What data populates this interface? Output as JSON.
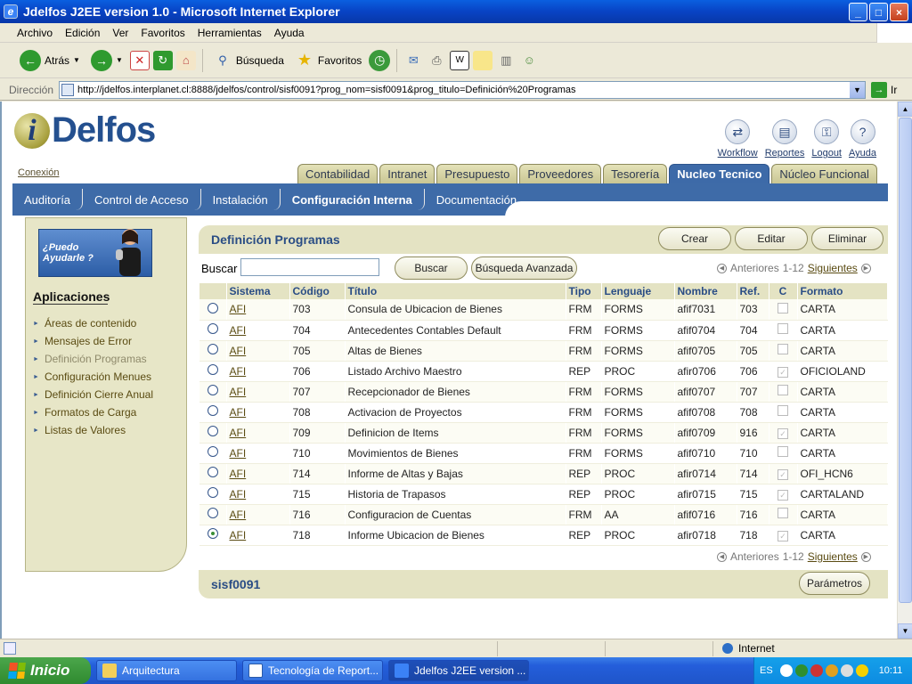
{
  "window": {
    "title": "Jdelfos J2EE version 1.0 - Microsoft Internet Explorer",
    "controls": {
      "minimize": "_",
      "maximize": "□",
      "close": "×"
    }
  },
  "menu": [
    "Archivo",
    "Edición",
    "Ver",
    "Favoritos",
    "Herramientas",
    "Ayuda"
  ],
  "toolbar": {
    "back": "Atrás",
    "search": "Búsqueda",
    "favorites": "Favoritos"
  },
  "address": {
    "label": "Dirección",
    "url": "http://jdelfos.interplanet.cl:8888/jdelfos/control/sisf0091?prog_nom=sisf0091&prog_titulo=Definición%20Programas",
    "go": "Ir"
  },
  "app": {
    "logo_i": "i",
    "logo_word": "Delfos",
    "conexion": "Conexión",
    "tools": [
      {
        "label": "Workflow",
        "icon": "workflow-icon",
        "glyph": "⇄"
      },
      {
        "label": "Reportes",
        "icon": "reports-icon",
        "glyph": "▤"
      },
      {
        "label": "Logout",
        "icon": "key-icon",
        "glyph": "⚿"
      },
      {
        "label": "Ayuda",
        "icon": "help-icon",
        "glyph": "?"
      }
    ],
    "top_tabs": [
      "Contabilidad",
      "Intranet",
      "Presupuesto",
      "Proveedores",
      "Tesorería",
      "Nucleo Tecnico",
      "Núcleo Funcional"
    ],
    "top_tab_active": "Nucleo Tecnico",
    "sub_tabs": [
      "Auditoría",
      "Control de Acceso",
      "Instalación",
      "Configuración Interna",
      "Documentación"
    ],
    "sub_tab_active": "Configuración Interna"
  },
  "sidebar": {
    "help_banner": "¿Puedo Ayudarle ?",
    "title": "Aplicaciones",
    "items": [
      "Áreas de contenido",
      "Mensajes de Error",
      "Definición Programas",
      "Configuración Menues",
      "Definición Cierre Anual",
      "Formatos de Carga",
      "Listas de Valores"
    ],
    "current": "Definición Programas"
  },
  "panel": {
    "title": "Definición Programas",
    "actions": {
      "create": "Crear",
      "edit": "Editar",
      "delete": "Eliminar"
    },
    "search_label": "Buscar",
    "search_value": "",
    "search_button": "Buscar",
    "advanced_button": "Búsqueda Avanzada",
    "pager_prev": "Anteriores",
    "pager_range": "1-12",
    "pager_next": "Siguientes",
    "footer_title": "sisf0091",
    "params_button": "Parámetros"
  },
  "table": {
    "headers": [
      "Sistema",
      "Código",
      "Título",
      "Tipo",
      "Lenguaje",
      "Nombre",
      "Ref.",
      "C",
      "Formato"
    ],
    "rows": [
      {
        "sistema": "AFI",
        "codigo": "703",
        "titulo": "Consula de Ubicacion de Bienes",
        "tipo": "FRM",
        "lenguaje": "FORMS",
        "nombre": "afif7031",
        "ref": "703",
        "c": false,
        "formato": "CARTA",
        "selected": false
      },
      {
        "sistema": "AFI",
        "codigo": "704",
        "titulo": "Antecedentes Contables Default",
        "tipo": "FRM",
        "lenguaje": "FORMS",
        "nombre": "afif0704",
        "ref": "704",
        "c": false,
        "formato": "CARTA",
        "selected": false
      },
      {
        "sistema": "AFI",
        "codigo": "705",
        "titulo": "Altas de Bienes",
        "tipo": "FRM",
        "lenguaje": "FORMS",
        "nombre": "afif0705",
        "ref": "705",
        "c": false,
        "formato": "CARTA",
        "selected": false
      },
      {
        "sistema": "AFI",
        "codigo": "706",
        "titulo": "Listado Archivo Maestro",
        "tipo": "REP",
        "lenguaje": "PROC",
        "nombre": "afir0706",
        "ref": "706",
        "c": true,
        "formato": "OFICIOLAND",
        "selected": false
      },
      {
        "sistema": "AFI",
        "codigo": "707",
        "titulo": "Recepcionador de Bienes",
        "tipo": "FRM",
        "lenguaje": "FORMS",
        "nombre": "afif0707",
        "ref": "707",
        "c": false,
        "formato": "CARTA",
        "selected": false
      },
      {
        "sistema": "AFI",
        "codigo": "708",
        "titulo": "Activacion de Proyectos",
        "tipo": "FRM",
        "lenguaje": "FORMS",
        "nombre": "afif0708",
        "ref": "708",
        "c": false,
        "formato": "CARTA",
        "selected": false
      },
      {
        "sistema": "AFI",
        "codigo": "709",
        "titulo": "Definicion de Items",
        "tipo": "FRM",
        "lenguaje": "FORMS",
        "nombre": "afif0709",
        "ref": "916",
        "c": true,
        "formato": "CARTA",
        "selected": false
      },
      {
        "sistema": "AFI",
        "codigo": "710",
        "titulo": "Movimientos de Bienes",
        "tipo": "FRM",
        "lenguaje": "FORMS",
        "nombre": "afif0710",
        "ref": "710",
        "c": false,
        "formato": "CARTA",
        "selected": false
      },
      {
        "sistema": "AFI",
        "codigo": "714",
        "titulo": "Informe de Altas y Bajas",
        "tipo": "REP",
        "lenguaje": "PROC",
        "nombre": "afir0714",
        "ref": "714",
        "c": true,
        "formato": "OFI_HCN6",
        "selected": false
      },
      {
        "sistema": "AFI",
        "codigo": "715",
        "titulo": "Historia de Trapasos",
        "tipo": "REP",
        "lenguaje": "PROC",
        "nombre": "afir0715",
        "ref": "715",
        "c": true,
        "formato": "CARTALAND",
        "selected": false
      },
      {
        "sistema": "AFI",
        "codigo": "716",
        "titulo": "Configuracion de Cuentas",
        "tipo": "FRM",
        "lenguaje": "AA",
        "nombre": "afif0716",
        "ref": "716",
        "c": false,
        "formato": "CARTA",
        "selected": false
      },
      {
        "sistema": "AFI",
        "codigo": "718",
        "titulo": "Informe Ubicacion de Bienes",
        "tipo": "REP",
        "lenguaje": "PROC",
        "nombre": "afir0718",
        "ref": "718",
        "c": true,
        "formato": "CARTA",
        "selected": true
      }
    ]
  },
  "status": {
    "zone": "Internet"
  },
  "taskbar": {
    "start": "Inicio",
    "tasks": [
      "Arquitectura",
      "Tecnología de Report...",
      "Jdelfos J2EE version ..."
    ],
    "active_task": "Jdelfos J2EE version ...",
    "lang": "ES",
    "clock": "10:11"
  }
}
